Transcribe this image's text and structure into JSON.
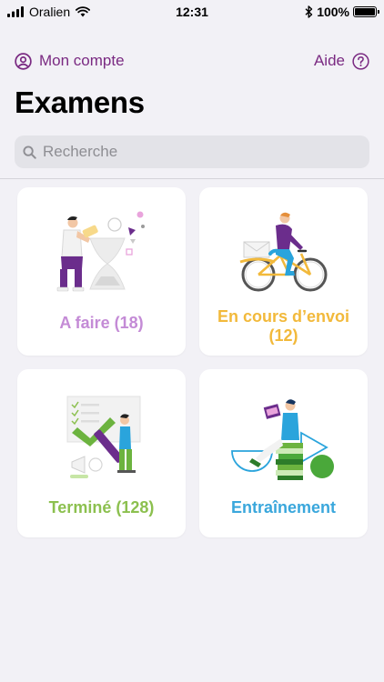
{
  "status_bar": {
    "carrier": "Oralien",
    "time": "12:31",
    "battery": "100%"
  },
  "header": {
    "account_label": "Mon compte",
    "help_label": "Aide",
    "title": "Examens"
  },
  "search": {
    "placeholder": "Recherche"
  },
  "cards": [
    {
      "label": "A faire (18)",
      "color": "#c48bd6"
    },
    {
      "label": "En cours d’envoi (12)",
      "color": "#f2b93b"
    },
    {
      "label": "Terminé (128)",
      "color": "#8cc04f"
    },
    {
      "label": "Entraînement",
      "color": "#3aa7dc"
    }
  ],
  "colors": {
    "accent": "#7a2a82",
    "background": "#f2f1f6",
    "search_bg": "#e3e3e8"
  },
  "icons": {
    "signal": "signal-bars-icon",
    "wifi": "wifi-icon",
    "bluetooth": "bluetooth-icon",
    "battery": "battery-icon",
    "account": "person-circle-icon",
    "help": "question-circle-icon",
    "search": "magnifier-icon"
  }
}
